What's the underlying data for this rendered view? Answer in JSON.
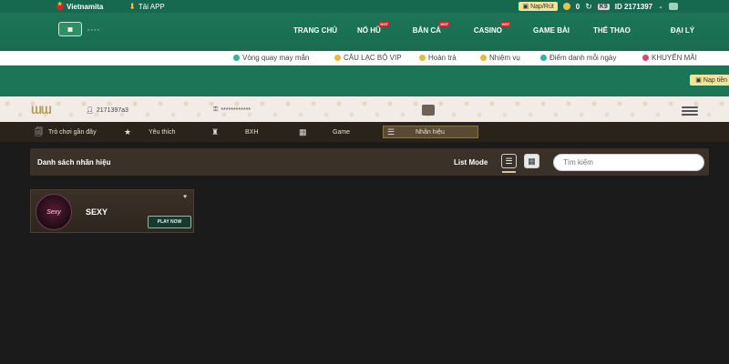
{
  "topbar": {
    "language": "Vietnamita",
    "app_label": "Tải APP",
    "deposit_label": "Nạp/Rút",
    "balance": "0",
    "vip_badge": "K9",
    "user_id": "ID 2171397"
  },
  "nav": {
    "items": [
      {
        "label": "TRANG CHỦ",
        "hot": ""
      },
      {
        "label": "NỔ HŨ",
        "hot": "HOT"
      },
      {
        "label": "BẮN CÁ",
        "hot": "HOT"
      },
      {
        "label": "CASINO",
        "hot": "HOT"
      },
      {
        "label": "GAME BÀI",
        "hot": ""
      },
      {
        "label": "THỂ THAO",
        "hot": ""
      },
      {
        "label": "ĐẠI LÝ",
        "hot": ""
      }
    ]
  },
  "promo": {
    "items": [
      {
        "label": "Vòng quay may mắn",
        "color": "#33b3a0"
      },
      {
        "label": "CÂU LẠC BỘ VIP",
        "color": "#e8b93b"
      },
      {
        "label": "Hoàn trả",
        "color": "#e8b93b"
      },
      {
        "label": "Nhiệm vụ",
        "color": "#e8b93b"
      },
      {
        "label": "Điểm danh mỗi ngày",
        "color": "#33b3a0"
      },
      {
        "label": "KHUYẾN MÃI",
        "color": "#d84a6b"
      }
    ]
  },
  "band": {
    "deposit_label": "Nạp tiền"
  },
  "profile": {
    "username": "2171397a3",
    "password_mask": "************"
  },
  "categories": [
    {
      "label": "Trò chơi gần đây",
      "icon": "recent-icon"
    },
    {
      "label": "Yêu thích",
      "icon": "star-icon"
    },
    {
      "label": "BXH",
      "icon": "podium-icon"
    },
    {
      "label": "Game",
      "icon": "grid-icon"
    },
    {
      "label": "Nhãn hiệu",
      "icon": "brand-icon"
    }
  ],
  "brand_panel": {
    "title": "Danh sách nhãn hiệu",
    "list_mode_label": "List Mode",
    "search_placeholder": "Tìm kiếm"
  },
  "brands": [
    {
      "name": "SEXY",
      "logo_text": "Sexy",
      "button": "PLAY NOW"
    }
  ],
  "colors": {
    "brand_green": "#1b7556",
    "accent_gold": "#f2e39a",
    "dark_bg": "#1b1b1b",
    "panel_brown": "#3a3228"
  }
}
